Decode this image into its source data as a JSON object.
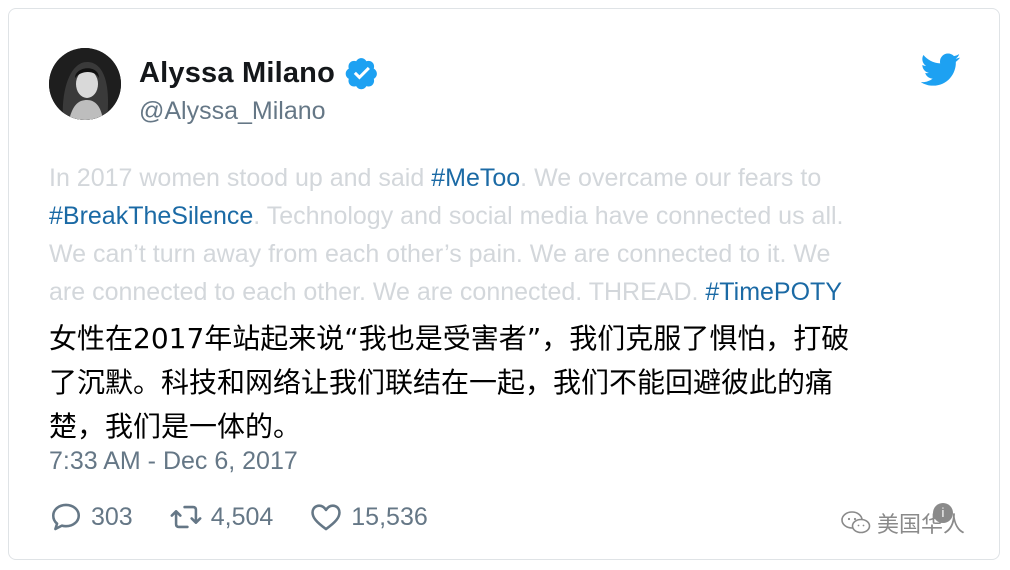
{
  "author": {
    "name": "Alyssa Milano",
    "handle": "@Alyssa_Milano",
    "verified": true
  },
  "tweet": {
    "lines": [
      [
        {
          "t": "In 2017 women stood up and said ",
          "tag": false
        },
        {
          "t": "#MeToo",
          "tag": true
        },
        {
          "t": ". We overcame our fears to",
          "tag": false
        }
      ],
      [
        {
          "t": "#BreakTheSilence",
          "tag": true
        },
        {
          "t": ". Technology and social media have connected us all.",
          "tag": false
        }
      ],
      [
        {
          "t": "We can’t turn away from each other’s pain. We are connected to it. We",
          "tag": false
        }
      ],
      [
        {
          "t": "are connected to each other. We are connected. THREAD. ",
          "tag": false
        },
        {
          "t": "#TimePOTY",
          "tag": true
        }
      ]
    ],
    "translation_lines": [
      "女性在2017年站起来说“我也是受害者”，我们克服了惧怕，打破",
      "了沉默。科技和网络让我们联结在一起，我们不能回避彼此的痛",
      "楚，我们是一体的。"
    ],
    "timestamp": "7:33 AM - Dec 6, 2017"
  },
  "actions": {
    "replies": "303",
    "retweets": "4,504",
    "likes": "15,536"
  },
  "watermark": {
    "text": "美国华人"
  },
  "colors": {
    "hashtag": "#1b6aa5",
    "faded_text": "#d3d7db",
    "secondary": "#657786",
    "twitter_blue": "#1da1f2"
  }
}
